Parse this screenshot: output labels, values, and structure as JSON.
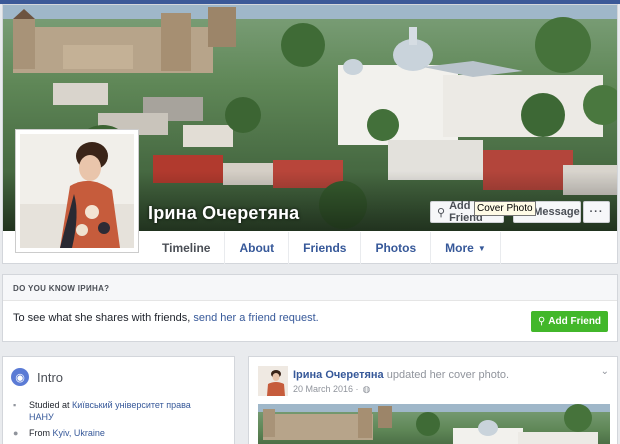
{
  "profile": {
    "name": "Ірина Очеретяна",
    "add_friend_label": "Add Friend",
    "message_label": "Message",
    "more_label": "···",
    "tooltip": "Cover Photo"
  },
  "tabs": [
    {
      "label": "Timeline"
    },
    {
      "label": "About"
    },
    {
      "label": "Friends"
    },
    {
      "label": "Photos"
    },
    {
      "label": "More",
      "has_dropdown": true
    }
  ],
  "do_you_know": {
    "heading": "DO YOU KNOW IPИНА?",
    "text_prefix": "To see what she shares with friends,",
    "text_link": "send her a friend request.",
    "button_label": "Add Friend"
  },
  "intro": {
    "title": "Intro",
    "studied_prefix": "Studied at",
    "studied_link": "Київський університет права НАНУ",
    "from_prefix": "From",
    "from_city": "Kyiv, Ukraine"
  },
  "post": {
    "author": "Ірина Очеретяна",
    "action": "updated her cover photo.",
    "date": "20 March 2016 ·"
  },
  "colors": {
    "brand": "#3b5998",
    "link": "#365899",
    "green": "#42b72a"
  }
}
